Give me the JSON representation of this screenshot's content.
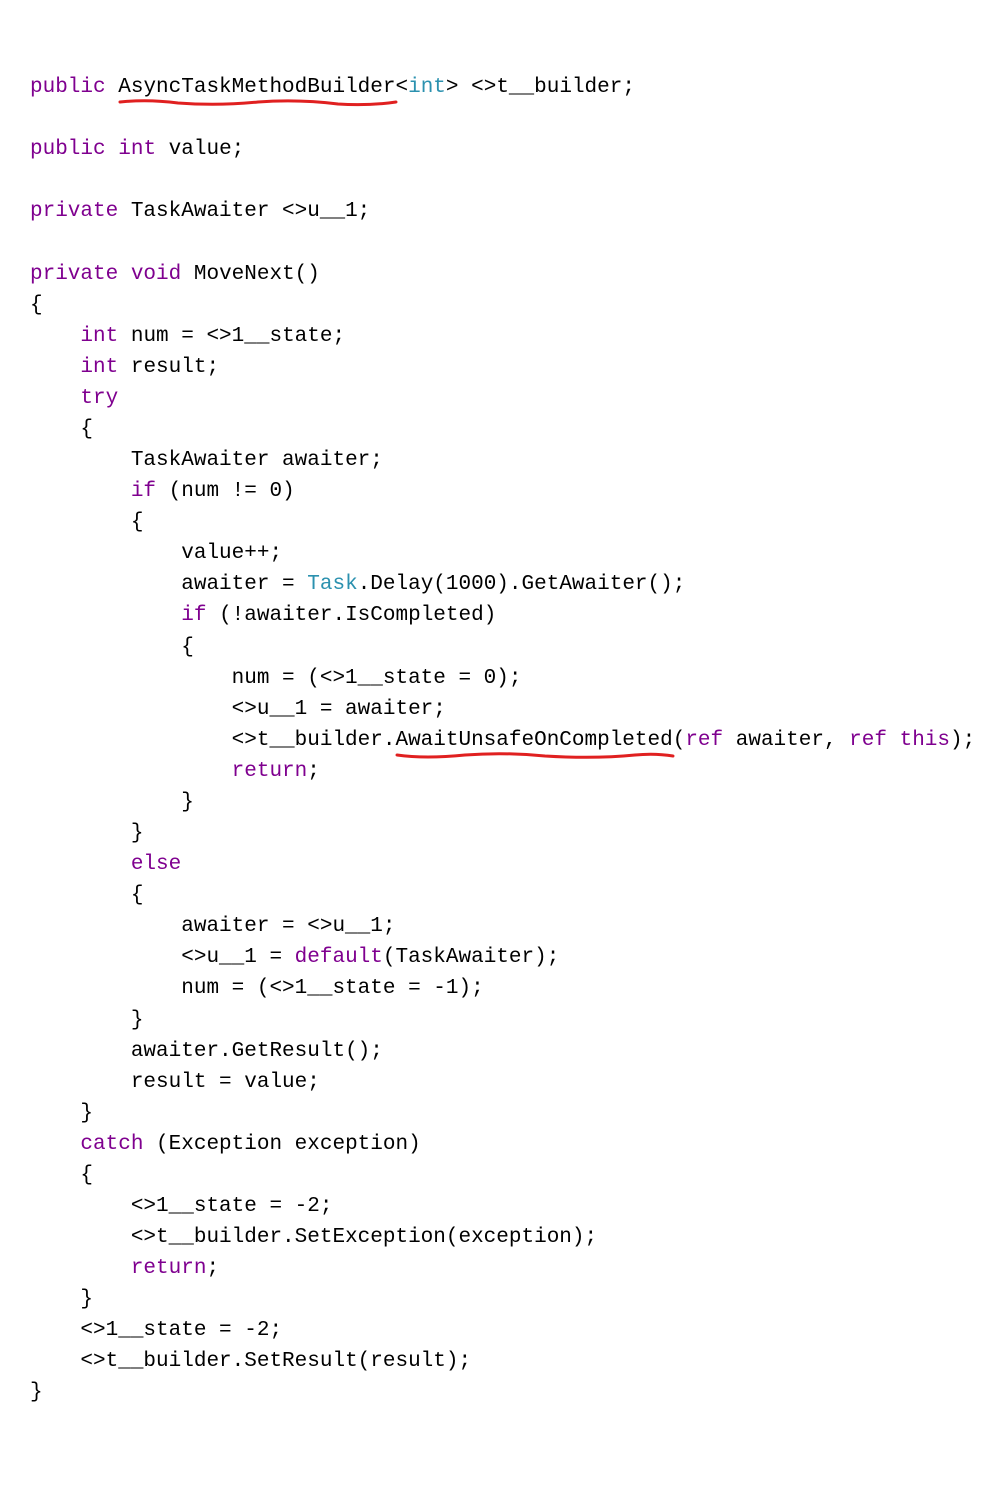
{
  "tokens": {
    "t1": "public",
    "t2": "AsyncTaskMethodBuilder",
    "t3": "int",
    "t4": "<>t__builder;",
    "t5": "public",
    "t6": "int",
    "t7": "value;",
    "t8": "private",
    "t9": "TaskAwaiter <>u__1;",
    "t10": "private",
    "t11": "void",
    "t12": "MoveNext()",
    "t13": "{",
    "t14": "int",
    "t15": "num = <>1__state;",
    "t16": "int",
    "t17": "result;",
    "t18": "try",
    "t19": "{",
    "t20": "TaskAwaiter awaiter;",
    "t21": "if",
    "t22": "(num != 0)",
    "t23": "{",
    "t24": "value++;",
    "t25": "awaiter = ",
    "t26": "Task",
    "t27": ".Delay(1000).GetAwaiter();",
    "t28": "if",
    "t29": "(!awaiter.IsCompleted)",
    "t30": "{",
    "t31": "num = (<>1__state = 0);",
    "t32": "<>u__1 = awaiter;",
    "t33": "<>t__builder.",
    "t34": "AwaitUnsafeOnCompleted",
    "t35": "(",
    "t36": "ref",
    "t37": "awaiter, ",
    "t38": "ref",
    "t39": "this",
    "t40": ");",
    "t41": "return",
    "t42": ";",
    "t43": "}",
    "t44": "}",
    "t45": "else",
    "t46": "{",
    "t47": "awaiter = <>u__1;",
    "t48": "<>u__1 = ",
    "t49": "default",
    "t50": "(TaskAwaiter);",
    "t51": "num = (<>1__state = -1);",
    "t52": "}",
    "t53": "awaiter.GetResult();",
    "t54": "result = value;",
    "t55": "}",
    "t56": "catch",
    "t57": "(Exception exception)",
    "t58": "{",
    "t59": "<>1__state = -2;",
    "t60": "<>t__builder.SetException(exception);",
    "t61": "return",
    "t62": ";",
    "t63": "}",
    "t64": "<>1__state = -2;",
    "t65": "<>t__builder.SetResult(result);",
    "t66": "}"
  },
  "annotations": [
    {
      "target": "AsyncTaskMethodBuilder",
      "style": "hand-underline-red"
    },
    {
      "target": "AwaitUnsafeOnCompleted",
      "style": "hand-underline-red"
    }
  ]
}
